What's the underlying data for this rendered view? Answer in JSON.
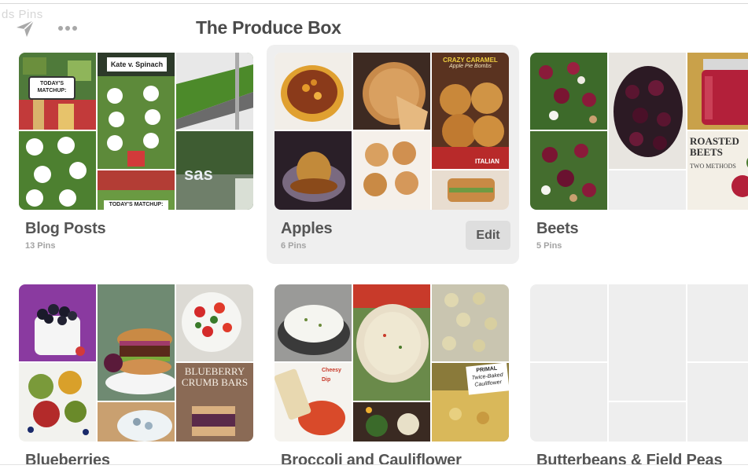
{
  "header": {
    "ghost_text": "ds    Pins",
    "title": "The Produce Box",
    "send_icon": "paper-plane-icon",
    "more_icon": "ellipsis-icon"
  },
  "boards": [
    {
      "title": "Blog Posts",
      "count": "13 Pins"
    },
    {
      "title": "Apples",
      "count": "6 Pins",
      "edit_label": "Edit"
    },
    {
      "title": "Beets",
      "count": "5 Pins"
    },
    {
      "title": "Blueberries",
      "count": ""
    },
    {
      "title": "Broccoli and Cauliflower",
      "count": ""
    },
    {
      "title": "Butterbeans & Field Peas",
      "count": ""
    }
  ],
  "cover_text": {
    "todays_matchup": "TODAY'S MATCHUP:",
    "kale_v_spinach": "Kate v. Spinach",
    "sas": "sas",
    "crazy_caramel": "CRAZY CARAMEL",
    "apple_pie_bombs": "Apple Pie Bombs",
    "italian": "ITALIAN",
    "roasted_beets": "ROASTED BEETS",
    "two_methods": "TWO METHODS",
    "blueberry_crumb_bars": "BLUEBERRY CRUMB BARS",
    "cheesy_dip": "Cheesy Dip",
    "primal": "PRIMAL",
    "twice_baked_cauliflower": "Twice-Baked Cauliflower"
  },
  "colors": {
    "card_highlight": "#efefef",
    "edit_button": "#dedede",
    "placeholder_tile": "#eeeeee",
    "title_text": "#4a4a4a"
  }
}
